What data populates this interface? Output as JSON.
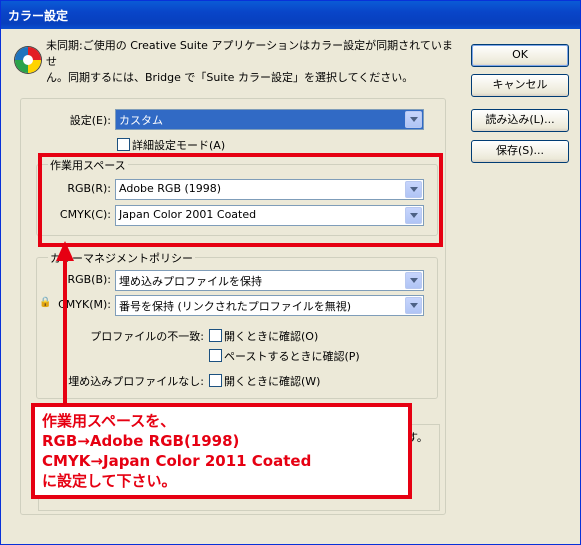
{
  "window": {
    "title": "カラー設定"
  },
  "notice": {
    "line1": "未同期:ご使用の Creative Suite アプリケーションはカラー設定が同期されていませ",
    "line2": "ん。同期するには、Bridge で「Suite カラー設定」を選択してください。"
  },
  "buttons": {
    "ok": "OK",
    "cancel": "キャンセル",
    "load": "読み込み(L)...",
    "save": "保存(S)..."
  },
  "settings": {
    "label": "設定(E):",
    "value": "カスタム",
    "advanced_mode_label": "詳細設定モード(A)",
    "advanced_mode_checked": false
  },
  "working_spaces": {
    "title": "作業用スペース",
    "rgb_label": "RGB(R):",
    "rgb_value": "Adobe RGB (1998)",
    "cmyk_label": "CMYK(C):",
    "cmyk_value": "Japan Color 2001 Coated"
  },
  "color_management": {
    "title": "カラーマネジメントポリシー",
    "rgb_label": "RGB(B):",
    "rgb_value": "埋め込みプロファイルを保持",
    "cmyk_label": "CMYK(M):",
    "cmyk_value": "番号を保持 (リンクされたプロファイルを無視)",
    "mismatch_label": "プロファイルの不一致:",
    "ask_open_label": "開くときに確認(O)",
    "ask_paste_label": "ペーストするときに確認(P)",
    "missing_label": "埋め込みプロファイルなし:",
    "missing_ask_open_label": "開くときに確認(W)"
  },
  "description_fragment": "ます。",
  "annotation": {
    "line1": "作業用スペースを、",
    "line2": "RGB→Adobe RGB(1998)",
    "line3": "CMYK→Japan Color 2011 Coated",
    "line4": "に設定して下さい。",
    "color": "#e60012"
  }
}
